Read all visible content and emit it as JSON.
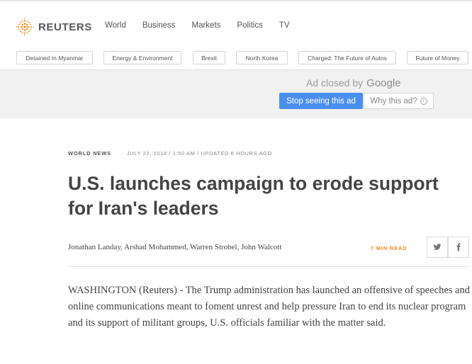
{
  "header": {
    "brand": "REUTERS",
    "nav": [
      "World",
      "Business",
      "Markets",
      "Politics",
      "TV"
    ],
    "topics": [
      "Detained In Myanmar",
      "Energy & Environment",
      "Brexit",
      "North Korea",
      "Charged: The Future of Autos",
      "Future of Money"
    ],
    "brand_color": "#f28b1a"
  },
  "ad": {
    "closed_by": "Ad closed by",
    "google": "Google",
    "stop_label": "Stop seeing this ad",
    "why_label": "Why this ad?",
    "stop_color": "#4a8ef0"
  },
  "article": {
    "section": "WORLD NEWS",
    "dateline": "JULY 22, 2018 / 1:50 AM / UPDATED 6 HOURS AGO",
    "headline": "U.S. launches campaign to erode support for Iran's leaders",
    "authors": "Jonathan Landay, Arshad Mohammed, Warren Strobel, John Walcott",
    "read_time": "7 MIN READ",
    "lead": "WASHINGTON (Reuters) - The Trump administration has launched an offensive of speeches and online communications meant to foment unrest and help pressure Iran to end its nuclear program and its support of militant groups, U.S. officials familiar with the matter said."
  },
  "icons": {
    "twitter": "twitter-icon",
    "facebook": "facebook-icon",
    "info": "info-icon",
    "logo": "reuters-logo-icon"
  }
}
